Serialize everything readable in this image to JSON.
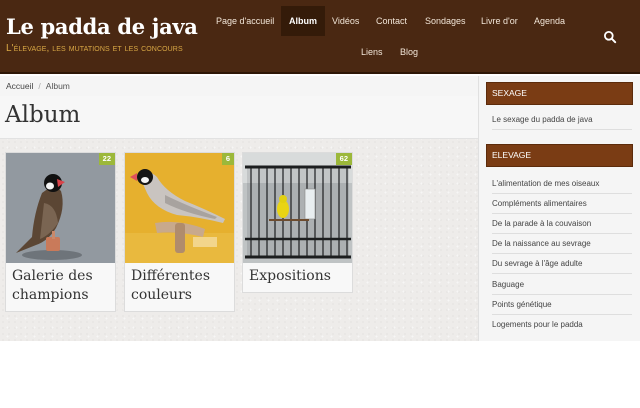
{
  "header": {
    "site_title": "Le padda de java",
    "tagline": "L'élevage, les mutations et les concours",
    "colors": {
      "background": "#4a2812",
      "tagline": "#d9a845",
      "active_nav": "#341b09"
    },
    "nav": [
      {
        "label": "Page d'accueil"
      },
      {
        "label": "Album",
        "active": true
      },
      {
        "label": "Vidéos"
      },
      {
        "label": "Contact"
      },
      {
        "label": "Sondages"
      },
      {
        "label": "Livre d'or"
      },
      {
        "label": "Agenda"
      },
      {
        "label": "Liens"
      },
      {
        "label": "Blog"
      }
    ],
    "search_icon": "search-icon"
  },
  "breadcrumb": {
    "home": "Accueil",
    "separator": "/",
    "current": "Album"
  },
  "page": {
    "title": "Album"
  },
  "albums": [
    {
      "title": "Galerie des champions",
      "count": "22"
    },
    {
      "title": "Différentes couleurs",
      "count": "6"
    },
    {
      "title": "Expositions",
      "count": "62"
    }
  ],
  "sidebar": {
    "colors": {
      "header_bg": "#7a3c14"
    },
    "sections": [
      {
        "title": "SEXAGE",
        "links": [
          "Le sexage du padda de java"
        ]
      },
      {
        "title": "ELEVAGE",
        "links": [
          "L'alimentation de mes oiseaux",
          "Compléments alimentaires",
          "De la parade à la couvaison",
          "De la naissance au sevrage",
          "Du sevrage à l'âge adulte",
          "Baguage",
          "Points génétique",
          "Logements pour le padda"
        ]
      }
    ]
  }
}
